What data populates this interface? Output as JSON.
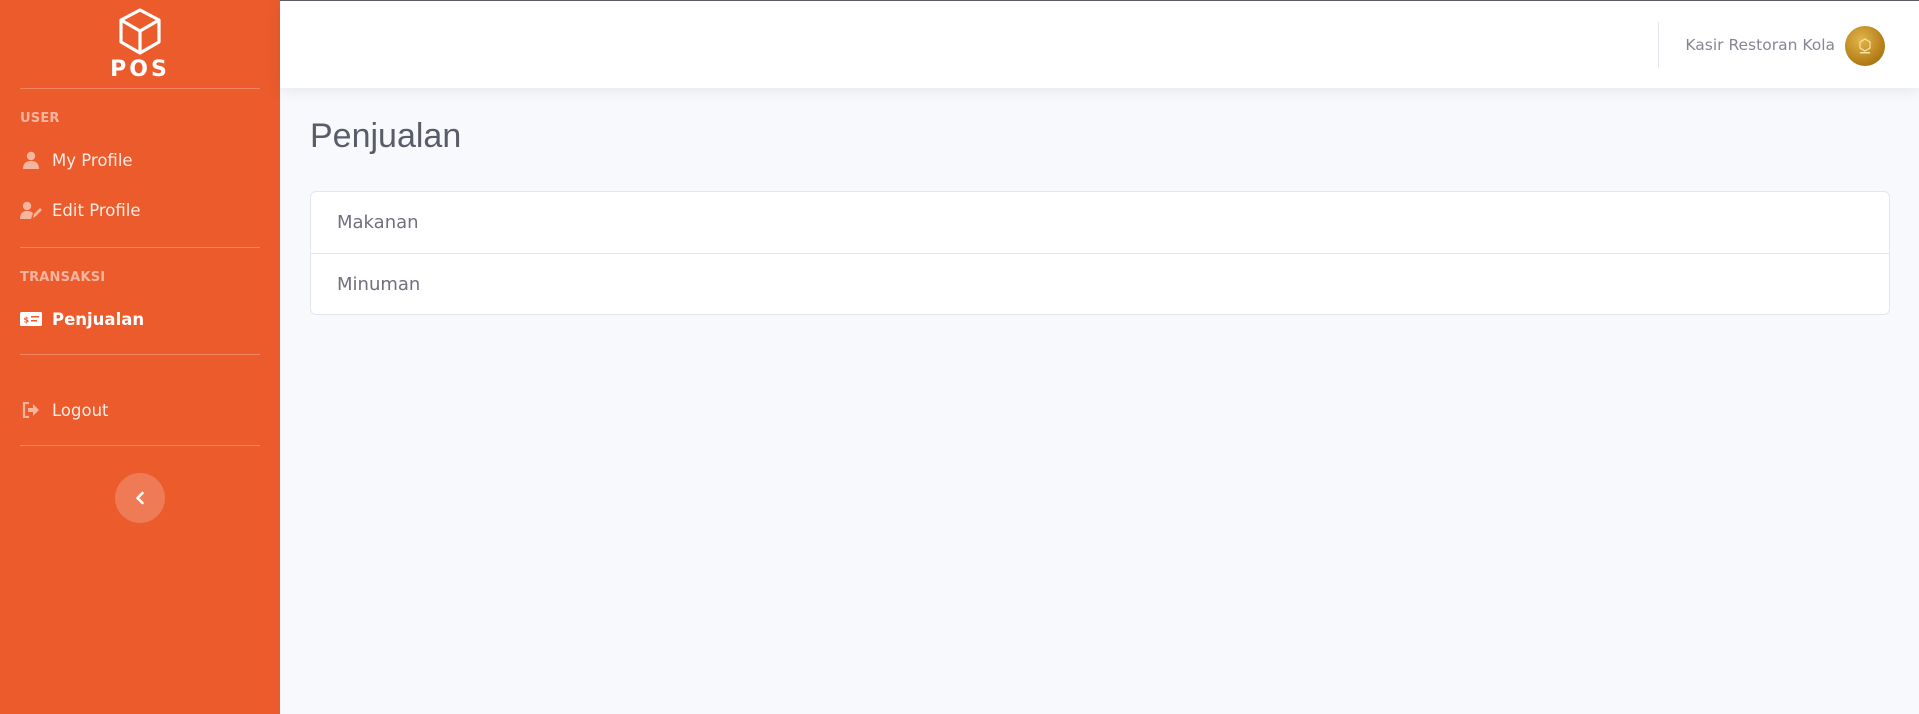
{
  "brand": {
    "logo_text": "POS"
  },
  "sidebar": {
    "headings": {
      "user": "USER",
      "transaksi": "TRANSAKSI"
    },
    "items": {
      "my_profile": "My Profile",
      "edit_profile": "Edit Profile",
      "penjualan": "Penjualan",
      "logout": "Logout"
    },
    "active": "Penjualan",
    "bg_color": "#ec5b2c"
  },
  "topbar": {
    "user_name": "Kasir Restoran Kola"
  },
  "main": {
    "title": "Penjualan",
    "list": [
      "Makanan",
      "Minuman"
    ]
  },
  "icons": {
    "brand": "cube-icon",
    "my_profile": "user-icon",
    "edit_profile": "user-edit-icon",
    "penjualan": "money-bill-icon",
    "logout": "sign-out-icon",
    "toggle": "chevron-left-icon"
  }
}
